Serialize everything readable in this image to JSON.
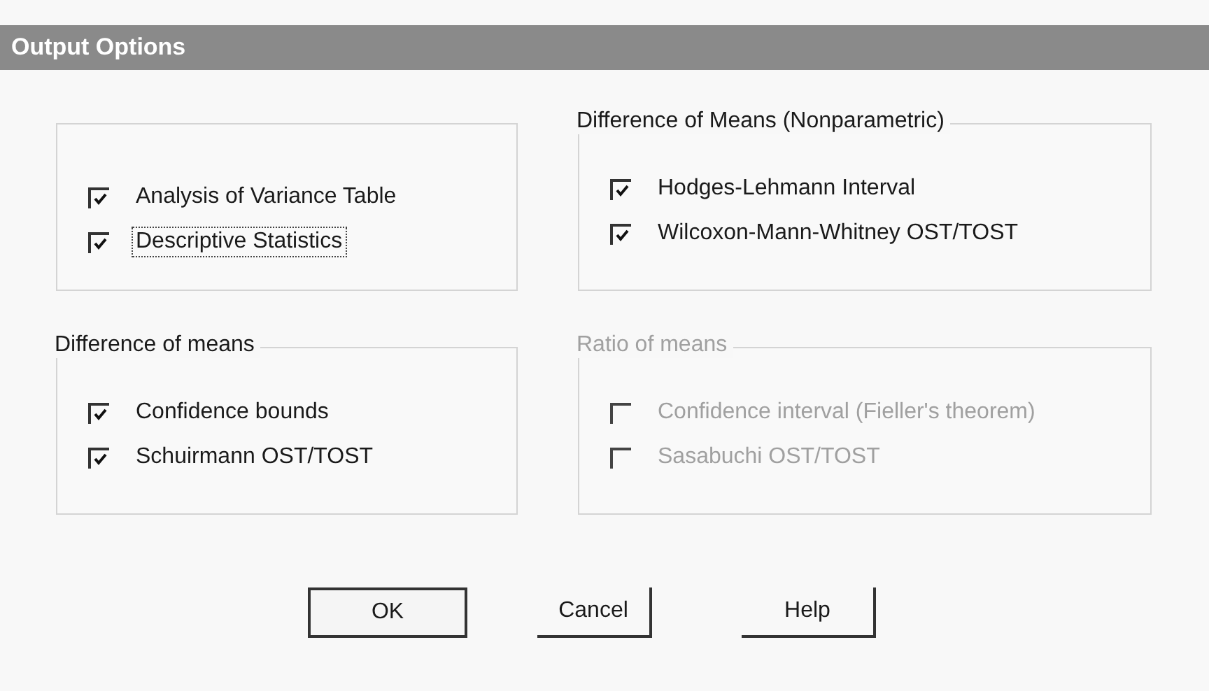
{
  "window": {
    "title": "Output Options"
  },
  "groups": [
    {
      "disabled": false,
      "options": [
        {
          "label": "Analysis of Variance Table",
          "checked": true,
          "focused": false
        },
        {
          "label": "Descriptive Statistics",
          "checked": true,
          "focused": true
        }
      ]
    },
    {
      "title": "Difference of Means (Nonparametric)",
      "disabled": false,
      "options": [
        {
          "label": "Hodges-Lehmann Interval",
          "checked": true,
          "focused": false
        },
        {
          "label": "Wilcoxon-Mann-Whitney OST/TOST",
          "checked": true,
          "focused": false
        }
      ]
    },
    {
      "title": "Difference of means",
      "disabled": false,
      "options": [
        {
          "label": "Confidence bounds",
          "checked": true,
          "focused": false
        },
        {
          "label": "Schuirmann OST/TOST",
          "checked": true,
          "focused": false
        }
      ]
    },
    {
      "title": "Ratio of means",
      "disabled": true,
      "options": [
        {
          "label": "Confidence interval (Fieller's theorem)",
          "checked": false,
          "focused": false
        },
        {
          "label": "Sasabuchi OST/TOST",
          "checked": false,
          "focused": false
        }
      ]
    }
  ],
  "buttons": [
    {
      "label": "OK",
      "default": true
    },
    {
      "label": "Cancel",
      "default": false
    },
    {
      "label": "Help",
      "default": false
    }
  ]
}
